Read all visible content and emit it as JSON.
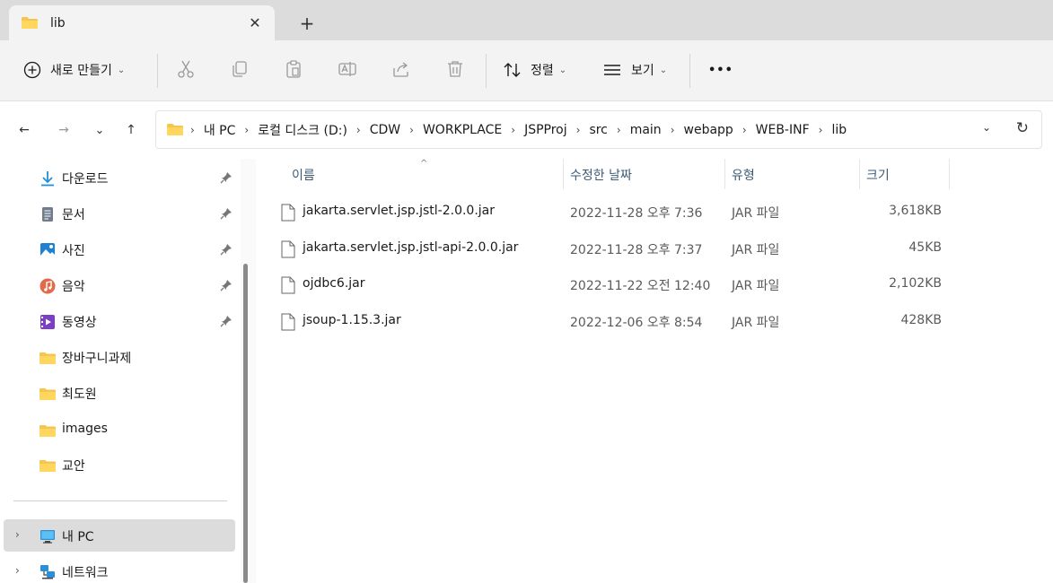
{
  "window": {
    "tab_title": "lib",
    "tab_close": "✕",
    "new_tab": "+"
  },
  "toolbar": {
    "new_label": "새로 만들기",
    "sort_label": "정렬",
    "view_label": "보기",
    "more_label": "•••",
    "chevron": "⌄"
  },
  "nav": {
    "back": "←",
    "forward": "→",
    "recent": "⌄",
    "up": "↑",
    "dropdown": "⌄",
    "refresh": "↻"
  },
  "breadcrumb": [
    "내 PC",
    "로컬 디스크 (D:)",
    "CDW",
    "WORKPLACE",
    "JSPProj",
    "src",
    "main",
    "webapp",
    "WEB-INF",
    "lib"
  ],
  "sidebar": {
    "items": [
      {
        "label": "다운로드",
        "icon": "download-icon",
        "pinned": true
      },
      {
        "label": "문서",
        "icon": "document-icon",
        "pinned": true
      },
      {
        "label": "사진",
        "icon": "pictures-icon",
        "pinned": true
      },
      {
        "label": "음악",
        "icon": "music-icon",
        "pinned": true
      },
      {
        "label": "동영상",
        "icon": "video-icon",
        "pinned": true
      },
      {
        "label": "장바구니과제",
        "icon": "folder-icon",
        "pinned": false
      },
      {
        "label": "최도원",
        "icon": "folder-icon",
        "pinned": false
      },
      {
        "label": "images",
        "icon": "folder-icon",
        "pinned": false
      },
      {
        "label": "교안",
        "icon": "folder-icon",
        "pinned": false
      }
    ],
    "tree": [
      {
        "label": "내 PC",
        "icon": "pc-icon",
        "selected": true
      },
      {
        "label": "네트워크",
        "icon": "network-icon",
        "selected": false
      }
    ],
    "expand": "›"
  },
  "filelist": {
    "sort_indicator": "^",
    "columns": {
      "name": "이름",
      "date": "수정한 날짜",
      "type": "유형",
      "size": "크기"
    },
    "rows": [
      {
        "name": "jakarta.servlet.jsp.jstl-2.0.0.jar",
        "date": "2022-11-28 오후 7:36",
        "type": "JAR 파일",
        "size": "3,618KB"
      },
      {
        "name": "jakarta.servlet.jsp.jstl-api-2.0.0.jar",
        "date": "2022-11-28 오후 7:37",
        "type": "JAR 파일",
        "size": "45KB"
      },
      {
        "name": "ojdbc6.jar",
        "date": "2022-11-22 오전 12:40",
        "type": "JAR 파일",
        "size": "2,102KB"
      },
      {
        "name": "jsoup-1.15.3.jar",
        "date": "2022-12-06 오후 8:54",
        "type": "JAR 파일",
        "size": "428KB"
      }
    ]
  },
  "colors": {
    "folder": "#f4c64f",
    "accent": "#0067c0",
    "header_text": "#3c5a74"
  }
}
